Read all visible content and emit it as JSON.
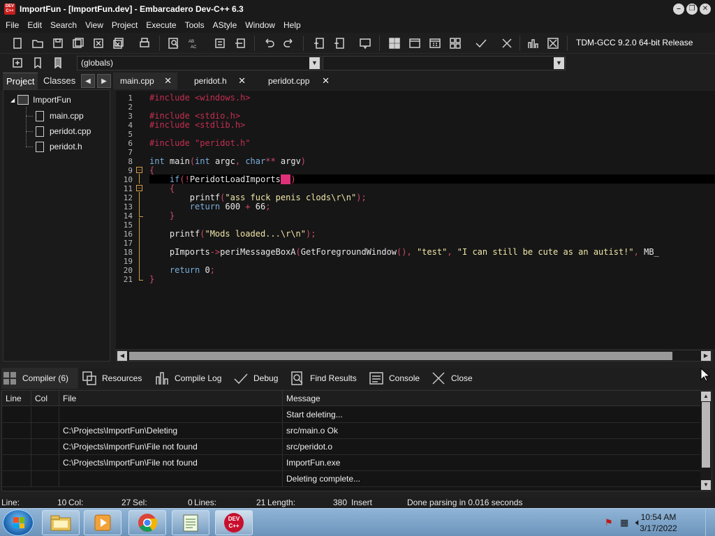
{
  "window": {
    "title": "ImportFun - [ImportFun.dev] - Embarcadero Dev-C++ 6.3",
    "app_icon_text": "DEV C++",
    "buttons": {
      "minimize": "–",
      "restore": "❐",
      "close": "✕"
    }
  },
  "menu": [
    "File",
    "Edit",
    "Search",
    "View",
    "Project",
    "Execute",
    "Tools",
    "AStyle",
    "Window",
    "Help"
  ],
  "toolbar": {
    "compiler": "TDM-GCC 9.2.0 64-bit Release",
    "scope_combo": "(globals)",
    "second_combo": "",
    "icons": [
      "new-file-icon",
      "open-folder-icon",
      "save-icon",
      "save-all-icon",
      "close-icon",
      "close-all-icon",
      "print-icon",
      "find-icon",
      "replace-icon",
      "indent-icon",
      "unindent-icon",
      "undo-icon",
      "redo-icon",
      "add-to-project-icon",
      "remove-from-project-icon",
      "project-options-icon",
      "compile-icon",
      "run-icon",
      "compile-run-icon",
      "rebuild-icon",
      "syntax-check-icon",
      "stop-icon",
      "chart-icon",
      "clean-icon"
    ]
  },
  "left_panel": {
    "tabs": [
      "Project",
      "Classes"
    ],
    "tree": {
      "root": "ImportFun",
      "files": [
        "main.cpp",
        "peridot.cpp",
        "peridot.h"
      ]
    }
  },
  "editor": {
    "tabs": [
      {
        "label": "main.cpp",
        "active": true
      },
      {
        "label": "peridot.h",
        "active": false
      },
      {
        "label": "peridot.cpp",
        "active": false
      }
    ],
    "close_glyph": "✕",
    "line_numbers": [
      "1",
      "2",
      "3",
      "4",
      "5",
      "6",
      "7",
      "8",
      "9",
      "10",
      "11",
      "12",
      "13",
      "14",
      "15",
      "16",
      "17",
      "18",
      "19",
      "20",
      "21"
    ],
    "code": {
      "l1": "#include <windows.h>",
      "l3": "#include <stdio.h>",
      "l4": "#include <stdlib.h>",
      "l6": "#include \"peridot.h\"",
      "l8_kw1": "int",
      "l8_fn": " main",
      "l8_p1": "(",
      "l8_kw2": "int",
      "l8_a": " argc",
      "l8_c": ",",
      "l8_kw3": " char",
      "l8_star": "**",
      "l8_b": " argv",
      "l8_p2": ")",
      "l9": "{",
      "l10_kw": "    if",
      "l10_p": "(!",
      "l10_fn": "PeridotLoadImports",
      "l10_hl": "()",
      "l10_end": ")",
      "l11": "    {",
      "l12_fn": "        printf",
      "l12_p": "(",
      "l12_s": "\"ass fuck penis clods\\r\\n\"",
      "l12_e": ");",
      "l13_kw": "        return",
      "l13_n": " 600 ",
      "l13_op": "+",
      "l13_n2": " 66",
      "l13_e": ";",
      "l14": "    }",
      "l16_fn": "    printf",
      "l16_p": "(",
      "l16_s": "\"Mods loaded...\\r\\n\"",
      "l16_e": ");",
      "l18_id": "    pImports",
      "l18_arrow": "->",
      "l18_fn": "periMessageBoxA",
      "l18_p": "(",
      "l18_fn2": "GetForegroundWindow",
      "l18_p2": "(), ",
      "l18_s1": "\"test\"",
      "l18_c": ", ",
      "l18_s2": "\"I can still be cute as an autist!\"",
      "l18_c2": ", ",
      "l18_rest": "MB_",
      "l20_kw": "    return",
      "l20_n": " 0",
      "l20_e": ";",
      "l21": "}"
    },
    "fold_plus": "−"
  },
  "bottom_panel": {
    "tabs": [
      {
        "label": "Compiler (6)",
        "icon": "grid-icon",
        "active": true
      },
      {
        "label": "Resources",
        "icon": "resources-icon"
      },
      {
        "label": "Compile Log",
        "icon": "chart-icon"
      },
      {
        "label": "Debug",
        "icon": "check-icon"
      },
      {
        "label": "Find Results",
        "icon": "find-icon"
      },
      {
        "label": "Console",
        "icon": "console-icon"
      },
      {
        "label": "Close",
        "icon": "close-icon"
      }
    ],
    "columns": [
      "Line",
      "Col",
      "File",
      "Message"
    ],
    "rows": [
      {
        "line": "",
        "col": "",
        "file": "",
        "message": "Start deleting..."
      },
      {
        "line": "",
        "col": "",
        "file": "C:\\Projects\\ImportFun\\Deleting",
        "message": "src/main.o Ok"
      },
      {
        "line": "",
        "col": "",
        "file": "C:\\Projects\\ImportFun\\File not found",
        "message": "src/peridot.o"
      },
      {
        "line": "",
        "col": "",
        "file": "C:\\Projects\\ImportFun\\File not found",
        "message": "ImportFun.exe"
      },
      {
        "line": "",
        "col": "",
        "file": "",
        "message": "Deleting complete..."
      }
    ]
  },
  "status": {
    "line_label": "Line:",
    "line_value": "10",
    "col_label": "Col:",
    "col_value": "27",
    "sel_label": "Sel:",
    "sel_value": "0",
    "lines_label": "Lines:",
    "lines_value": "21",
    "length_label": "Length:",
    "length_value": "380",
    "mode": "Insert",
    "message": "Done parsing in 0.016 seconds"
  },
  "taskbar": {
    "items": [
      "explorer-icon",
      "media-player-icon",
      "chrome-icon",
      "notepad-icon",
      "devcpp-icon"
    ],
    "devcpp_text": "DEV C++",
    "time": "10:54 AM",
    "date": "3/17/2022",
    "tray_icons": [
      "flag-icon",
      "network-icon",
      "volume-icon"
    ]
  },
  "colors": {
    "keyword": "#79aedc",
    "preprocessor": "#c42e52",
    "string": "#f0e6a8",
    "fold_marker": "#d8a04a",
    "brace_highlight": "#e0307a"
  }
}
